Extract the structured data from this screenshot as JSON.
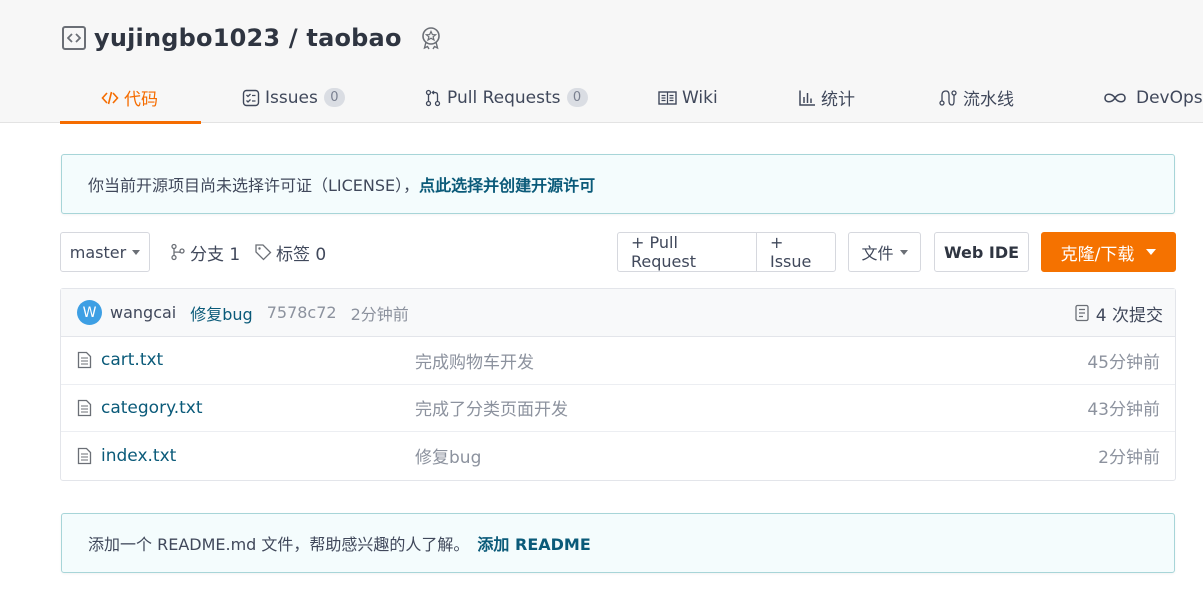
{
  "repo": {
    "owner": "yujingbo1023",
    "separator": "/",
    "name": "taobao"
  },
  "tabs": [
    {
      "label": "代码",
      "active": true,
      "icon": "code-icon"
    },
    {
      "label": "Issues",
      "count": "0",
      "icon": "issues-icon"
    },
    {
      "label": "Pull Requests",
      "count": "0",
      "icon": "pull-request-icon"
    },
    {
      "label": "Wiki",
      "icon": "wiki-icon"
    },
    {
      "label": "统计",
      "icon": "stats-icon"
    },
    {
      "label": "流水线",
      "icon": "pipeline-icon"
    },
    {
      "label": "DevOps",
      "icon": "devops-icon"
    }
  ],
  "license_notice": {
    "text": "你当前开源项目尚未选择许可证（LICENSE），",
    "link": "点此选择并创建开源许可"
  },
  "toolbar": {
    "branch": "master",
    "branches_label": "分支 1",
    "tags_label": "标签 0",
    "pull_request": "+ Pull Request",
    "issue": "+ Issue",
    "file_menu": "文件",
    "web_ide": "Web IDE",
    "clone_download": "克隆/下载"
  },
  "latest_commit": {
    "avatar_letter": "W",
    "author": "wangcai",
    "message": "修复bug",
    "hash": "7578c72",
    "time": "2分钟前",
    "commit_count": "4 次提交"
  },
  "files": [
    {
      "name": "cart.txt",
      "message": "完成购物车开发",
      "time": "45分钟前"
    },
    {
      "name": "category.txt",
      "message": "完成了分类页面开发",
      "time": "43分钟前"
    },
    {
      "name": "index.txt",
      "message": "修复bug",
      "time": "2分钟前"
    }
  ],
  "readme_notice": {
    "text": "添加一个 README.md 文件，帮助感兴趣的人了解。",
    "link": "添加 README"
  },
  "colors": {
    "accent": "#f56c00",
    "link": "#0a5a79",
    "notice_bg": "#f4fcfd",
    "notice_border": "#a7d5d8"
  }
}
